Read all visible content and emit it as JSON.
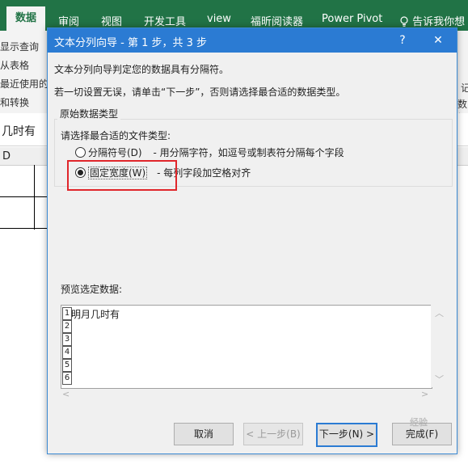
{
  "excel": {
    "ribbon_tabs": [
      "数据",
      "审阅",
      "视图",
      "开发工具",
      "view",
      "福昕阅读器",
      "Power Pivot",
      "告诉我你想"
    ],
    "ribbon_left_items": [
      "显示查询",
      "从表格",
      "最近使用的",
      "和转换"
    ],
    "formula_bar_text": "几时有",
    "column_header": "D",
    "right_fragments": [
      "记",
      "数据"
    ]
  },
  "dialog": {
    "title": "文本分列向导 - 第 1 步，共 3 步",
    "help_label": "?",
    "close_label": "✕",
    "line1": "文本分列向导判定您的数据具有分隔符。",
    "line2": "若一切设置无误，请单击“下一步”，否则请选择最合适的数据类型。",
    "group_title": "原始数据类型",
    "group_prompt": "请选择最合适的文件类型:",
    "options": [
      {
        "label": "分隔符号(D)",
        "description": "- 用分隔字符，如逗号或制表符分隔每个字段",
        "selected": false
      },
      {
        "label": "固定宽度(W)",
        "description": "- 每列字段加空格对齐",
        "selected": true
      }
    ],
    "preview_label": "预览选定数据:",
    "preview_rows": [
      "1",
      "2",
      "3",
      "4",
      "5",
      "6"
    ],
    "preview_text": "明月几时有",
    "buttons": {
      "cancel": "取消",
      "back": "< 上一步(B)",
      "next": "下一步(N) >",
      "finish": "完成(F)"
    },
    "accent_color": "#2b7bd3",
    "highlight_color": "#e0262b"
  },
  "watermark": "经验"
}
